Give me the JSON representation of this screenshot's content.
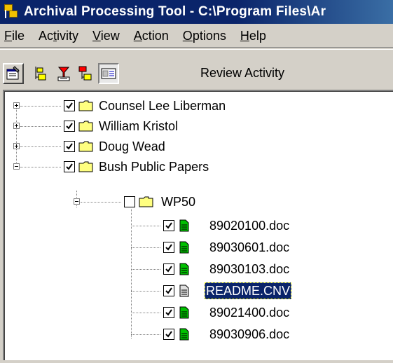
{
  "window": {
    "title": "Archival Processing Tool - C:\\Program Files\\Ar"
  },
  "menu": [
    {
      "pre": "",
      "key": "F",
      "post": "ile"
    },
    {
      "pre": "Ac",
      "key": "t",
      "post": "ivity"
    },
    {
      "pre": "",
      "key": "V",
      "post": "iew"
    },
    {
      "pre": "",
      "key": "A",
      "post": "ction"
    },
    {
      "pre": "",
      "key": "O",
      "post": "ptions"
    },
    {
      "pre": "",
      "key": "H",
      "post": "elp"
    }
  ],
  "toolbar": {
    "review_label": "Review Activity",
    "buttons": [
      {
        "icon": "properties-icon"
      },
      {
        "icon": "tree-expand-icon"
      },
      {
        "icon": "tree-remove-icon"
      },
      {
        "icon": "tree-collapse-icon"
      },
      {
        "icon": "review-activity-icon"
      }
    ]
  },
  "tree": {
    "colors": {
      "selection_bg": "#0a246a",
      "folder_yellow": "#ffff80",
      "doc_green": "#00c000",
      "doc_gray": "#c0c0c0"
    },
    "nodes": [
      {
        "label": "Counsel Lee Liberman",
        "checked": true,
        "expanded": false,
        "type": "folder"
      },
      {
        "label": "William Kristol",
        "checked": true,
        "expanded": false,
        "type": "folder"
      },
      {
        "label": "Doug Wead",
        "checked": true,
        "expanded": false,
        "type": "folder"
      },
      {
        "label": "Bush Public Papers",
        "checked": true,
        "expanded": true,
        "type": "folder"
      },
      {
        "label": "WP50",
        "checked": false,
        "expanded": true,
        "type": "folder"
      },
      {
        "label": "89020100.doc",
        "checked": true,
        "type": "doc",
        "status": "green"
      },
      {
        "label": "89030601.doc",
        "checked": true,
        "type": "doc",
        "status": "green"
      },
      {
        "label": "89030103.doc",
        "checked": true,
        "type": "doc",
        "status": "green"
      },
      {
        "label": "README.CNV",
        "checked": true,
        "type": "doc",
        "status": "gray",
        "selected": true
      },
      {
        "label": "89021400.doc",
        "checked": true,
        "type": "doc",
        "status": "green"
      },
      {
        "label": "89030906.doc",
        "checked": true,
        "type": "doc",
        "status": "green"
      }
    ]
  }
}
